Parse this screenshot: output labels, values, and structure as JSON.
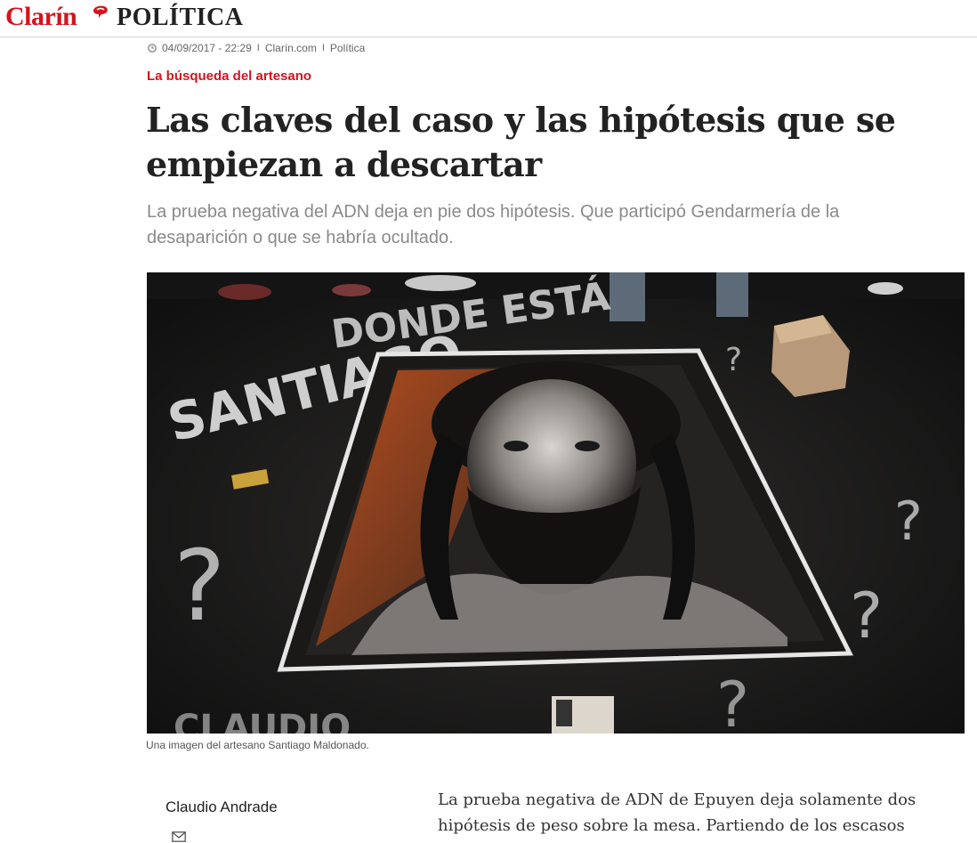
{
  "header": {
    "brand": "Clarín",
    "section": "POLÍTICA"
  },
  "meta": {
    "datetime": "04/09/2017 - 22:29",
    "site": "Clarín.com",
    "category": "Política"
  },
  "article": {
    "kicker": "La búsqueda del artesano",
    "headline": "Las claves del caso y las hipótesis que se empiezan a descartar",
    "subhead": "La prueba negativa del ADN deja en pie dos hipótesis. Que participó Gendarmería de la desaparición o que se habría ocultado.",
    "image_caption": "Una imagen del artesano Santiago Maldonado.",
    "image_text": {
      "top": "DONDE ESTÁ",
      "name": "SANTIAGO",
      "bottom": "CLAUDIO"
    },
    "author": "Claudio Andrade",
    "body_first": "La prueba negativa de ADN de Epuyen deja solamente dos hipótesis de peso sobre la mesa. Partiendo de los escasos datos"
  },
  "colors": {
    "brand_red": "#d3131d",
    "text_dark": "#222222",
    "subhead_gray": "#8a8a8a"
  },
  "icons": {
    "clock": "clock-icon",
    "mail": "mail-icon",
    "logo": "speech-bubble-logo-icon"
  }
}
